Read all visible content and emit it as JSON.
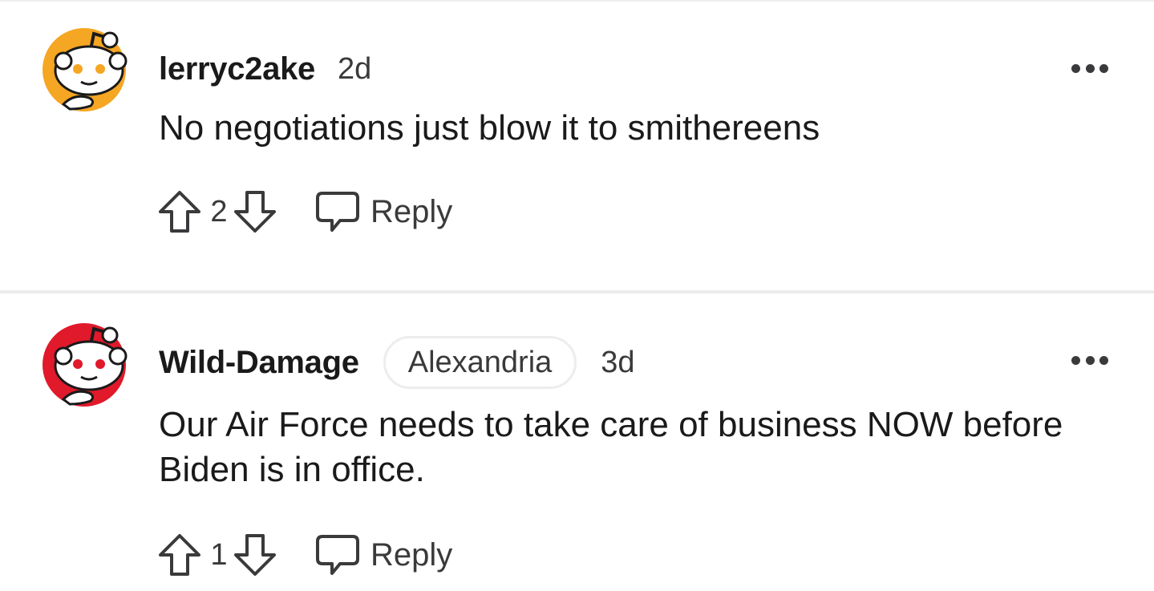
{
  "comments": [
    {
      "username": "lerryc2ake",
      "time": "2d",
      "flair": "",
      "body": "No negotiations just blow it to smithereens",
      "score": "2",
      "reply_label": "Reply",
      "avatar_color": "#f5a623"
    },
    {
      "username": "Wild-Damage",
      "time": "3d",
      "flair": "Alexandria",
      "body": "Our Air Force needs to take care of business NOW before Biden is in office.",
      "score": "1",
      "reply_label": "Reply",
      "avatar_color": "#e0192b"
    }
  ],
  "icons": {
    "avatar": "snoo-avatar-icon",
    "upvote": "upvote-arrow-icon",
    "downvote": "downvote-arrow-icon",
    "reply": "speech-bubble-icon",
    "more": "more-options-icon"
  },
  "colors": {
    "text": "#1a1a1b",
    "meta": "#3a3a3c",
    "divider": "#ececec"
  }
}
